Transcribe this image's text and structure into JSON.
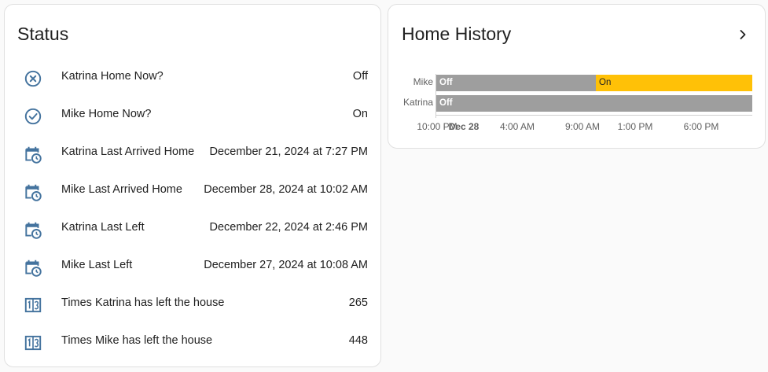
{
  "status": {
    "title": "Status",
    "rows": [
      {
        "icon": "close-circle-outline-icon",
        "name": "Katrina Home Now?",
        "value": "Off"
      },
      {
        "icon": "check-circle-outline-icon",
        "name": "Mike Home Now?",
        "value": "On"
      },
      {
        "icon": "calendar-clock-icon",
        "name": "Katrina Last Arrived Home",
        "value": "December 21, 2024 at 7:27 PM"
      },
      {
        "icon": "calendar-clock-icon",
        "name": "Mike Last Arrived Home",
        "value": "December 28, 2024 at 10:02 AM"
      },
      {
        "icon": "calendar-clock-icon",
        "name": "Katrina Last Left",
        "value": "December 22, 2024 at 2:46 PM"
      },
      {
        "icon": "calendar-clock-icon",
        "name": "Mike Last Left",
        "value": "December 27, 2024 at 10:08 AM"
      },
      {
        "icon": "counter-icon",
        "name": "Times Katrina has left the house",
        "value": "265"
      },
      {
        "icon": "counter-icon",
        "name": "Times Mike has left the house",
        "value": "448"
      }
    ]
  },
  "history": {
    "title": "Home History",
    "rows": [
      {
        "name": "Mike",
        "segments": [
          {
            "label": "Off",
            "state": "off"
          },
          {
            "label": "On",
            "state": "on"
          }
        ]
      },
      {
        "name": "Katrina",
        "segments": [
          {
            "label": "Off",
            "state": "off"
          }
        ]
      }
    ],
    "ticks": [
      "10:00 PM",
      "Dec 28",
      "4:00 AM",
      "9:00 AM",
      "1:00 PM",
      "6:00 PM"
    ],
    "colors": {
      "off": "#9e9e9e",
      "on": "#ffc107"
    }
  },
  "colors": {
    "icon": "#44739e",
    "text": "#212121",
    "muted": "#616161"
  }
}
